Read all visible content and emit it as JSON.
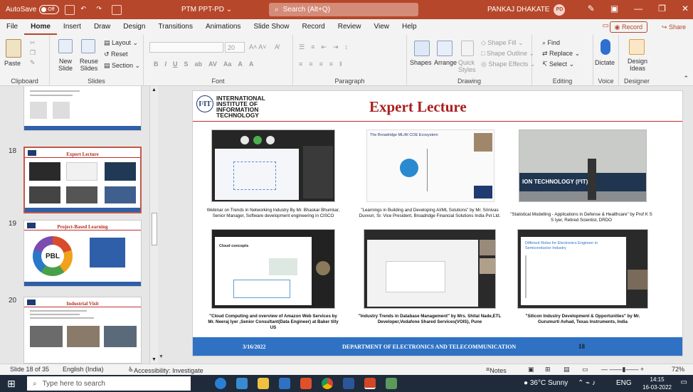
{
  "titlebar": {
    "autosave_label": "AutoSave",
    "autosave_state": "Off",
    "doc_title": "PTM PPT-PD",
    "search_placeholder": "Search (Alt+Q)",
    "user_name": "PANKAJ DHAKATE",
    "user_initials": "PD"
  },
  "menu": {
    "tabs": [
      "File",
      "Home",
      "Insert",
      "Draw",
      "Design",
      "Transitions",
      "Animations",
      "Slide Show",
      "Record",
      "Review",
      "View",
      "Help"
    ],
    "active": "Home",
    "record_button": "Record",
    "share_button": "Share"
  },
  "ribbon": {
    "groups": {
      "clipboard": "Clipboard",
      "slides": "Slides",
      "font": "Font",
      "paragraph": "Paragraph",
      "drawing": "Drawing",
      "editing": "Editing",
      "voice": "Voice",
      "designer": "Designer"
    },
    "paste": "Paste",
    "new_slide": "New Slide",
    "reuse_slides": "Reuse Slides",
    "layout": "Layout",
    "reset": "Reset",
    "section": "Section",
    "font_size": "20",
    "shapes": "Shapes",
    "arrange": "Arrange",
    "quick_styles": "Quick Styles",
    "shape_fill": "Shape Fill",
    "shape_outline": "Shape Outline",
    "shape_effects": "Shape Effects",
    "find": "Find",
    "replace": "Replace",
    "select": "Select",
    "dictate": "Dictate",
    "design_ideas": "Design Ideas"
  },
  "thumbnails": [
    {
      "number": "",
      "title": ""
    },
    {
      "number": "18",
      "title": "Expert Lecture"
    },
    {
      "number": "19",
      "title": "Project-Based Learning",
      "badge": "PBL"
    },
    {
      "number": "20",
      "title": "Industrial Visit"
    }
  ],
  "slide": {
    "logo_lines": [
      "INTERNATIONAL",
      "INSTITUTE OF",
      "INFORMATION",
      "TECHNOLOGY"
    ],
    "logo_mark": "I²IT",
    "title": "Expert Lecture",
    "captions": [
      "Webinar on Trends in Networking Industry By Mr. Bhaskar Bhumkar, Senior Manager, Software development engineering in CISCO",
      "\"Learnings in Building and Developing AI/ML Solutions\" by Mr. Srinivas Duvvuri, Sr. Vice President, Broadridge Financial Solutions India Pvt Ltd.",
      "\"Statistical Modelling - Applications in Defense & Healthcare\" by Prof K S S Iyer, Retired Scientist, DRDO",
      "\"Cloud Computing and overview of Amazon Web Services by Mr. Neeraj Iyer ,Senior Consultant(Data Engineer) at Baker tilly US",
      "\"Industry Trends in Database Management\" by Mrs. Shital Nade,ETL Developer,Vodafone Shared Services(VOIS), Pune",
      "\"Silicon Industry Development & Opportunities\" by Mr. Gurumurti Avhad, Texas Instruments, India"
    ],
    "photo_labels": {
      "p2": "The Broadridge ML/AI COE Ecosystem",
      "p3": "ION TECHNOLOGY (I²IT)",
      "p4": "Cloud concepts",
      "p6": "Different Roles for Electronics Engineer in Semiconductor Industry"
    },
    "footer_date": "3/16/2022",
    "footer_dept": "DEPARTMENT OF ELECTRONICS AND TELECOMMUNICATION",
    "footer_num": "18"
  },
  "status": {
    "slide_of": "Slide 18 of 35",
    "language": "English (India)",
    "accessibility": "Accessibility: Investigate",
    "notes": "Notes",
    "zoom": "72%"
  },
  "taskbar": {
    "search_placeholder": "Type here to search",
    "weather": "36°C  Sunny",
    "lang": "ENG",
    "time": "14:15",
    "date": "16-03-2022"
  },
  "colors": {
    "accent": "#b7472a",
    "slide_title": "#a82020",
    "footer": "#2f72c4"
  }
}
